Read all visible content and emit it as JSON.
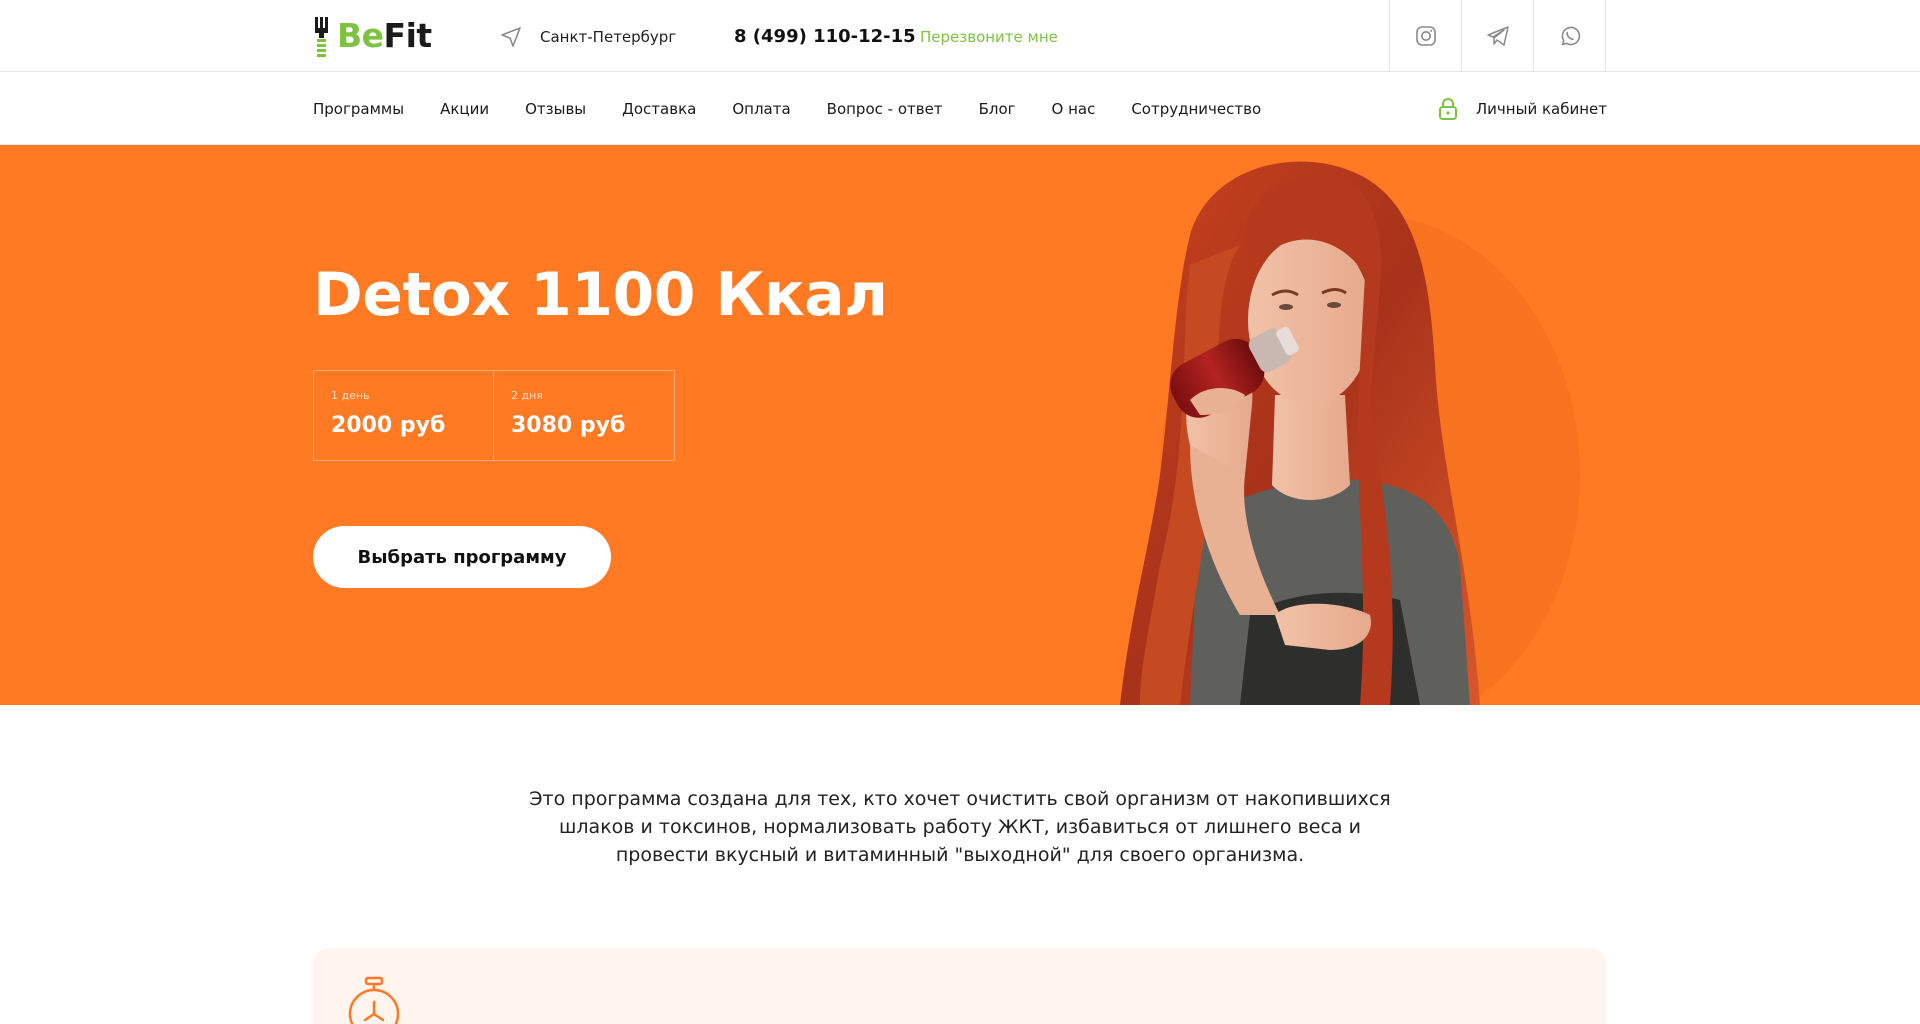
{
  "brand": {
    "prefix": "Be",
    "suffix": "Fit",
    "accent_color": "#7dc242",
    "dark_color": "#1a1a1a"
  },
  "header": {
    "location_icon": "location-arrow-icon",
    "city": "Санкт-Петербург",
    "phone": "8 (499) 110-12-15",
    "callback_label": "Перезвоните мне",
    "socials": [
      {
        "icon": "instagram-icon"
      },
      {
        "icon": "telegram-icon"
      },
      {
        "icon": "whatsapp-icon"
      }
    ]
  },
  "nav": {
    "items": [
      {
        "label": "Программы"
      },
      {
        "label": "Акции"
      },
      {
        "label": "Отзывы"
      },
      {
        "label": "Доставка"
      },
      {
        "label": "Оплата"
      },
      {
        "label": "Вопрос - ответ"
      },
      {
        "label": "Блог"
      },
      {
        "label": "О нас"
      },
      {
        "label": "Сотрудничество"
      }
    ],
    "account_icon": "lock-icon",
    "account_label": "Личный кабинет"
  },
  "hero": {
    "background_color": "#ff7a23",
    "title": "Detox 1100 Ккал",
    "prices": [
      {
        "period": "1 день",
        "price": "2000 руб"
      },
      {
        "period": "2 дня",
        "price": "3080 руб"
      }
    ],
    "cta_label": "Выбрать программу"
  },
  "intro": {
    "lines": [
      "Это программа создана для тех, кто хочет очистить свой организм от накопившихся",
      "шлаков и токсинов, нормализовать работу ЖКТ, избавиться от лишнего веса и",
      "провести вкусный и витаминный \"выходной\" для своего организма."
    ]
  },
  "feature_card": {
    "icon": "stopwatch-icon",
    "background_color": "#fff5ee"
  }
}
